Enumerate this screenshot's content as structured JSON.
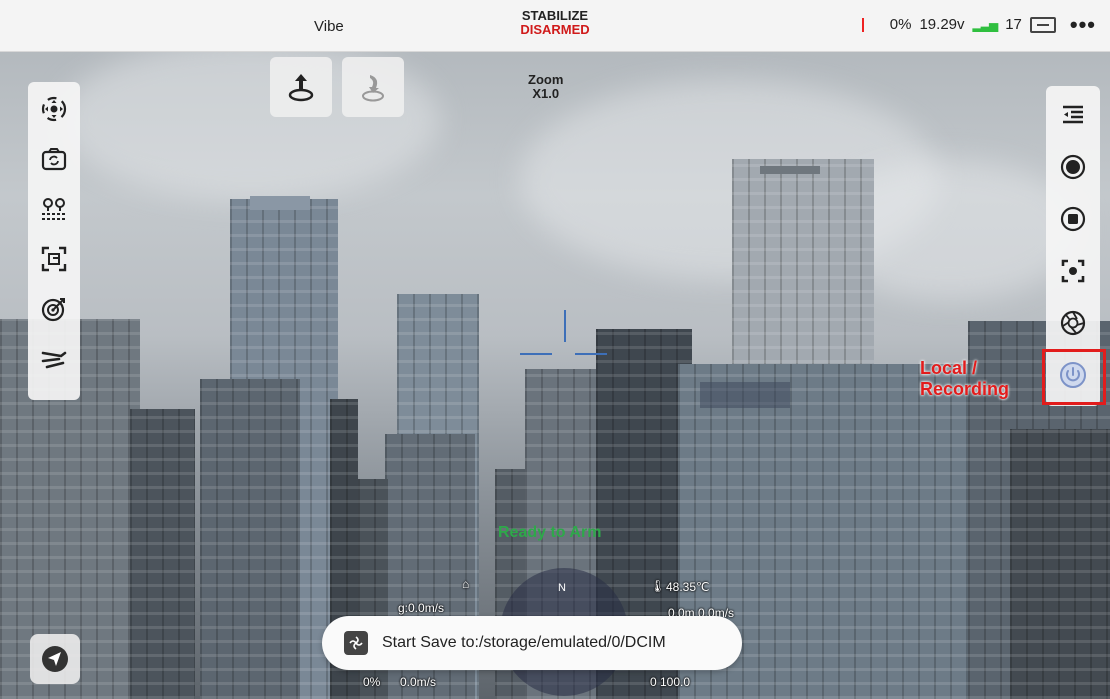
{
  "topbar": {
    "app_name": "Vibe",
    "flight_mode": "STABILIZE",
    "arm_state": "DISARMED",
    "battery_percent": "0%",
    "voltage": "19.29v",
    "satellite_count": "17",
    "signal_icon": "signal-bars-icon",
    "rc_icon": "remote-controller-icon",
    "more_icon": "more-dots-icon",
    "more_label": "•••"
  },
  "flight_buttons": {
    "takeoff_icon": "takeoff-icon",
    "return_icon": "return-home-icon"
  },
  "zoom": {
    "label": "Zoom",
    "value": "X1.0"
  },
  "left_toolbar": {
    "items": [
      {
        "name": "gimbal-center-icon"
      },
      {
        "name": "camera-switch-icon"
      },
      {
        "name": "waypoint-icon"
      },
      {
        "name": "focus-frame-icon"
      },
      {
        "name": "target-track-icon"
      },
      {
        "name": "flight-path-icon"
      }
    ]
  },
  "right_toolbar": {
    "items": [
      {
        "name": "menu-collapse-icon"
      },
      {
        "name": "capture-photo-icon"
      },
      {
        "name": "stop-record-icon"
      },
      {
        "name": "focus-point-icon"
      },
      {
        "name": "aperture-icon"
      },
      {
        "name": "local-recording-icon"
      }
    ]
  },
  "annotation": {
    "line1": "Local /",
    "line2": "Recording",
    "color": "#e21c1c"
  },
  "telemetry": {
    "status": "Ready to Arm",
    "temperature": "48.35℃",
    "ground_speed": "g:0.0m/s",
    "distance_speed": "0.0m 0.0m/s",
    "throttle": "0%",
    "vertical_speed": "0.0m/s",
    "battery_value": "0 100.0",
    "compass_north": "N"
  },
  "toast": {
    "text": "Start Save to:/storage/emulated/0/DCIM"
  },
  "nav_button": {
    "icon": "navigation-arrow-icon"
  }
}
